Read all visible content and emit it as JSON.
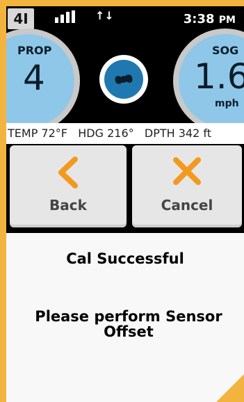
{
  "status": {
    "badge": "4I",
    "time": "3:38",
    "ampm": "PM",
    "signal_icon": "signal-bars-icon",
    "data_icon": "data-transfer-icon"
  },
  "gauges": {
    "left": {
      "label": "PROP",
      "value": "4"
    },
    "right": {
      "label": "SOG",
      "value": "1.6",
      "unit": "mph"
    },
    "center_icon": "propeller-icon"
  },
  "infobar": {
    "temp": "TEMP 72°F",
    "hdg": "HDG 216°",
    "depth": "DPTH 342 ft"
  },
  "buttons": {
    "back": {
      "label": "Back",
      "icon": "back-chevron-icon"
    },
    "cancel": {
      "label": "Cancel",
      "icon": "cancel-x-icon"
    }
  },
  "message": {
    "title": "Cal Successful",
    "line1": "Please perform Sensor",
    "line2": "Offset"
  },
  "colors": {
    "accent": "#f39a1e",
    "gauge_blue": "#8fc7e8",
    "frame": "#f3b43f"
  }
}
